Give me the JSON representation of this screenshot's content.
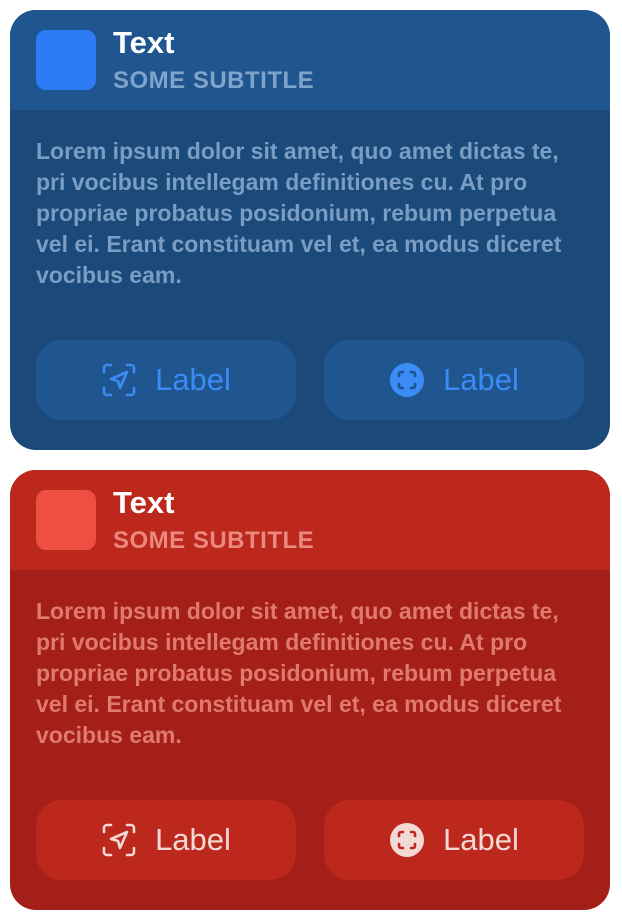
{
  "cards": [
    {
      "theme": "blue",
      "accent": "#2d7cf6",
      "title": "Text",
      "subtitle": "SOME SUBTITLE",
      "body": "Lorem ipsum dolor sit amet, quo amet dictas te, pri vocibus intellegam definitiones cu. At pro propriae probatus posidonium, rebum perpetua vel ei. Erant constituam vel et, ea modus diceret vocibus eam.",
      "buttons": [
        {
          "icon": "location-viewfinder-icon",
          "label": "Label"
        },
        {
          "icon": "viewfinder-circle-icon",
          "label": "Label"
        }
      ]
    },
    {
      "theme": "red",
      "accent": "#ee4f40",
      "title": "Text",
      "subtitle": "SOME SUBTITLE",
      "body": "Lorem ipsum dolor sit amet, quo amet dictas te, pri vocibus intellegam definitiones cu. At pro propriae probatus posidonium, rebum perpetua vel ei. Erant constituam vel et, ea modus diceret vocibus eam.",
      "buttons": [
        {
          "icon": "location-viewfinder-icon",
          "label": "Label"
        },
        {
          "icon": "viewfinder-circle-icon",
          "label": "Label"
        }
      ]
    }
  ]
}
